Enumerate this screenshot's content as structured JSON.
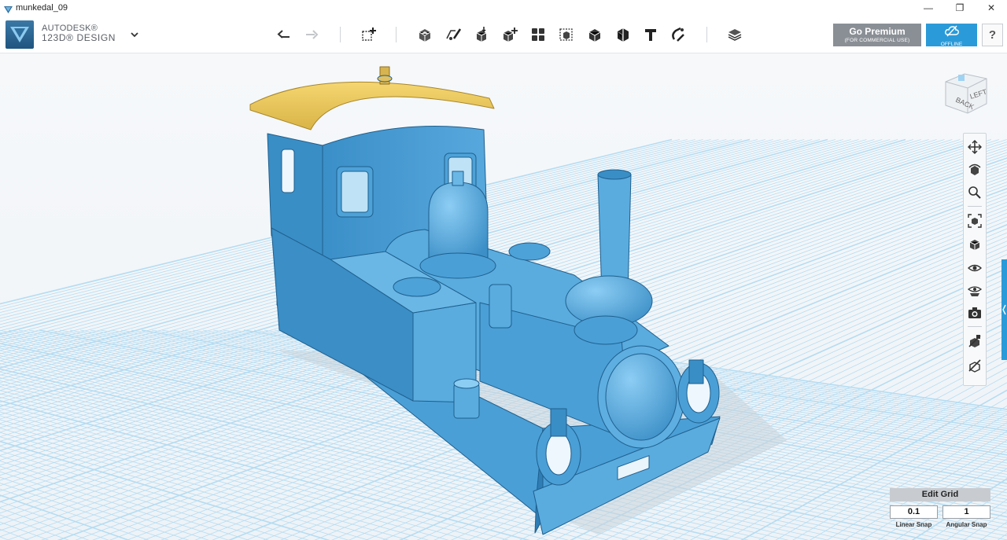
{
  "window": {
    "title": "munkedal_09",
    "controls": {
      "minimize": "—",
      "restore": "❐",
      "close": "✕"
    }
  },
  "brand": {
    "line1": "AUTODESK®",
    "line2": "123D® DESIGN"
  },
  "toolbar": {
    "tools": [
      "undo-icon",
      "redo-icon",
      "primitives-icon",
      "sketch-icon",
      "construct-icon",
      "modify-icon",
      "pattern-icon",
      "grouping-icon",
      "combine-icon",
      "measure-icon",
      "text-icon",
      "snap-icon",
      "materials-icon"
    ],
    "go_premium": {
      "label": "Go Premium",
      "sublabel": "(FOR COMMERCIAL USE)"
    },
    "offline": {
      "label": "OFFLINE"
    },
    "help": {
      "label": "?"
    }
  },
  "viewcube": {
    "face1": "BACK",
    "face2": "LEFT"
  },
  "navbar": {
    "tools": [
      "pan-icon",
      "orbit-icon",
      "zoom-icon",
      "fit-icon",
      "perspective-icon",
      "visibility-icon",
      "camera-views-icon",
      "screenshot-icon",
      "material-display-icon",
      "outline-icon"
    ]
  },
  "edit_grid": {
    "title": "Edit Grid",
    "linear_snap": {
      "value": "0.1",
      "label": "Linear Snap"
    },
    "angular_snap": {
      "value": "1",
      "label": "Angular Snap"
    }
  },
  "colors": {
    "model_blue": "#4a9fd6",
    "roof_yellow": "#ecc75a",
    "grid_line": "#a8d4ee",
    "accent": "#2b9ad8"
  }
}
